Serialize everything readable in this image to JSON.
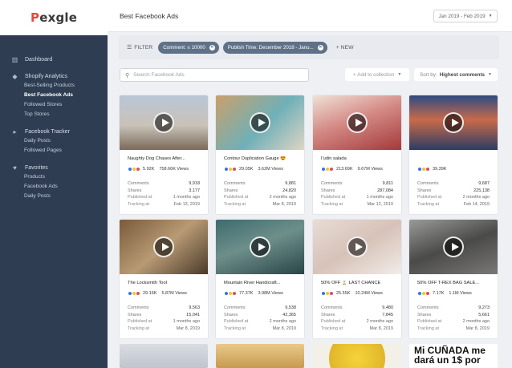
{
  "app": {
    "logo_p": "P",
    "logo_rest": "exgle"
  },
  "sidebar": {
    "dashboard": "Dashboard",
    "shopify": {
      "title": "Shopify Analytics",
      "items": [
        "Best-Selling Products",
        "Best Facebook Ads",
        "Followed Stores",
        "Top Stores"
      ]
    },
    "facebook": {
      "title": "Facebook Tracker",
      "items": [
        "Daily Posts",
        "Followed Pages"
      ]
    },
    "favorites": {
      "title": "Favorites",
      "items": [
        "Products",
        "Facebook Ads",
        "Daily Posts"
      ]
    }
  },
  "header": {
    "title": "Best Facebook Ads",
    "date_range": "Jan 2019 - Feb 2019"
  },
  "filters": {
    "label": "FILTER",
    "chips": [
      "Comment: ≤ 10000",
      "Publish Time: December 2018 - Janu..."
    ],
    "add_new": "NEW"
  },
  "search": {
    "placeholder": "Search Facebook Ads"
  },
  "toolbar": {
    "add_collection": "Add to collection",
    "sort_label": "Sort by:",
    "sort_value": "Highest comments"
  },
  "labels": {
    "comments": "Comments",
    "shares": "Shares",
    "published": "Published at",
    "tracking": "Tracking at"
  },
  "cards": [
    {
      "title": "Naughty Dog Chases After...",
      "reactions": "5.92K",
      "views": "758.66K Views",
      "comments": "9,918",
      "shares": "3,177",
      "published": "1 months ago",
      "tracking": "Feb 13, 2019"
    },
    {
      "title": "Contour Duplication Gauge 😍",
      "reactions": "29.05K",
      "views": "3.62M Views",
      "comments": "9,881",
      "shares": "24,820",
      "published": "2 months ago",
      "tracking": "Mar 8, 2019"
    },
    {
      "title": "I'udin salada",
      "reactions": "213.69K",
      "views": "9.67M Views",
      "comments": "9,811",
      "shares": "287,084",
      "published": "1 months ago",
      "tracking": "Mar 12, 2019"
    },
    {
      "title": "",
      "reactions": "39.39K",
      "views": "",
      "comments": "9,687",
      "shares": "225,138",
      "published": "2 months ago",
      "tracking": "Feb 14, 2019"
    },
    {
      "title": "The Locksmith Tool",
      "reactions": "29.16K",
      "views": "5.87M Views",
      "comments": "9,563",
      "shares": "15,041",
      "published": "1 months ago",
      "tracking": "Mar 8, 2019"
    },
    {
      "title": "Mountain River Handicraft...",
      "reactions": "77.37K",
      "views": "3.98M Views",
      "comments": "9,538",
      "shares": "42,365",
      "published": "2 months ago",
      "tracking": "Mar 8, 2019"
    },
    {
      "title": "50% OFF ⏳ LAST CHANCE",
      "reactions": "25.55K",
      "views": "10.24M Views",
      "comments": "9,480",
      "shares": "7,845",
      "published": "2 months ago",
      "tracking": "Mar 8, 2019"
    },
    {
      "title": "50% OFF T-REX BAG SALE...",
      "reactions": "7.17K",
      "views": "1.1M Views",
      "comments": "9,273",
      "shares": "5,661",
      "published": "2 months ago",
      "tracking": "Mar 8, 2019"
    }
  ],
  "bottom_meme": "Mi CUÑADA me dará un 1$ por",
  "colors": {
    "sidebar": "#2e3d52",
    "chip": "#5e7186",
    "like": "#3b6ee8",
    "haha": "#f3c530",
    "love": "#e24b5b"
  }
}
